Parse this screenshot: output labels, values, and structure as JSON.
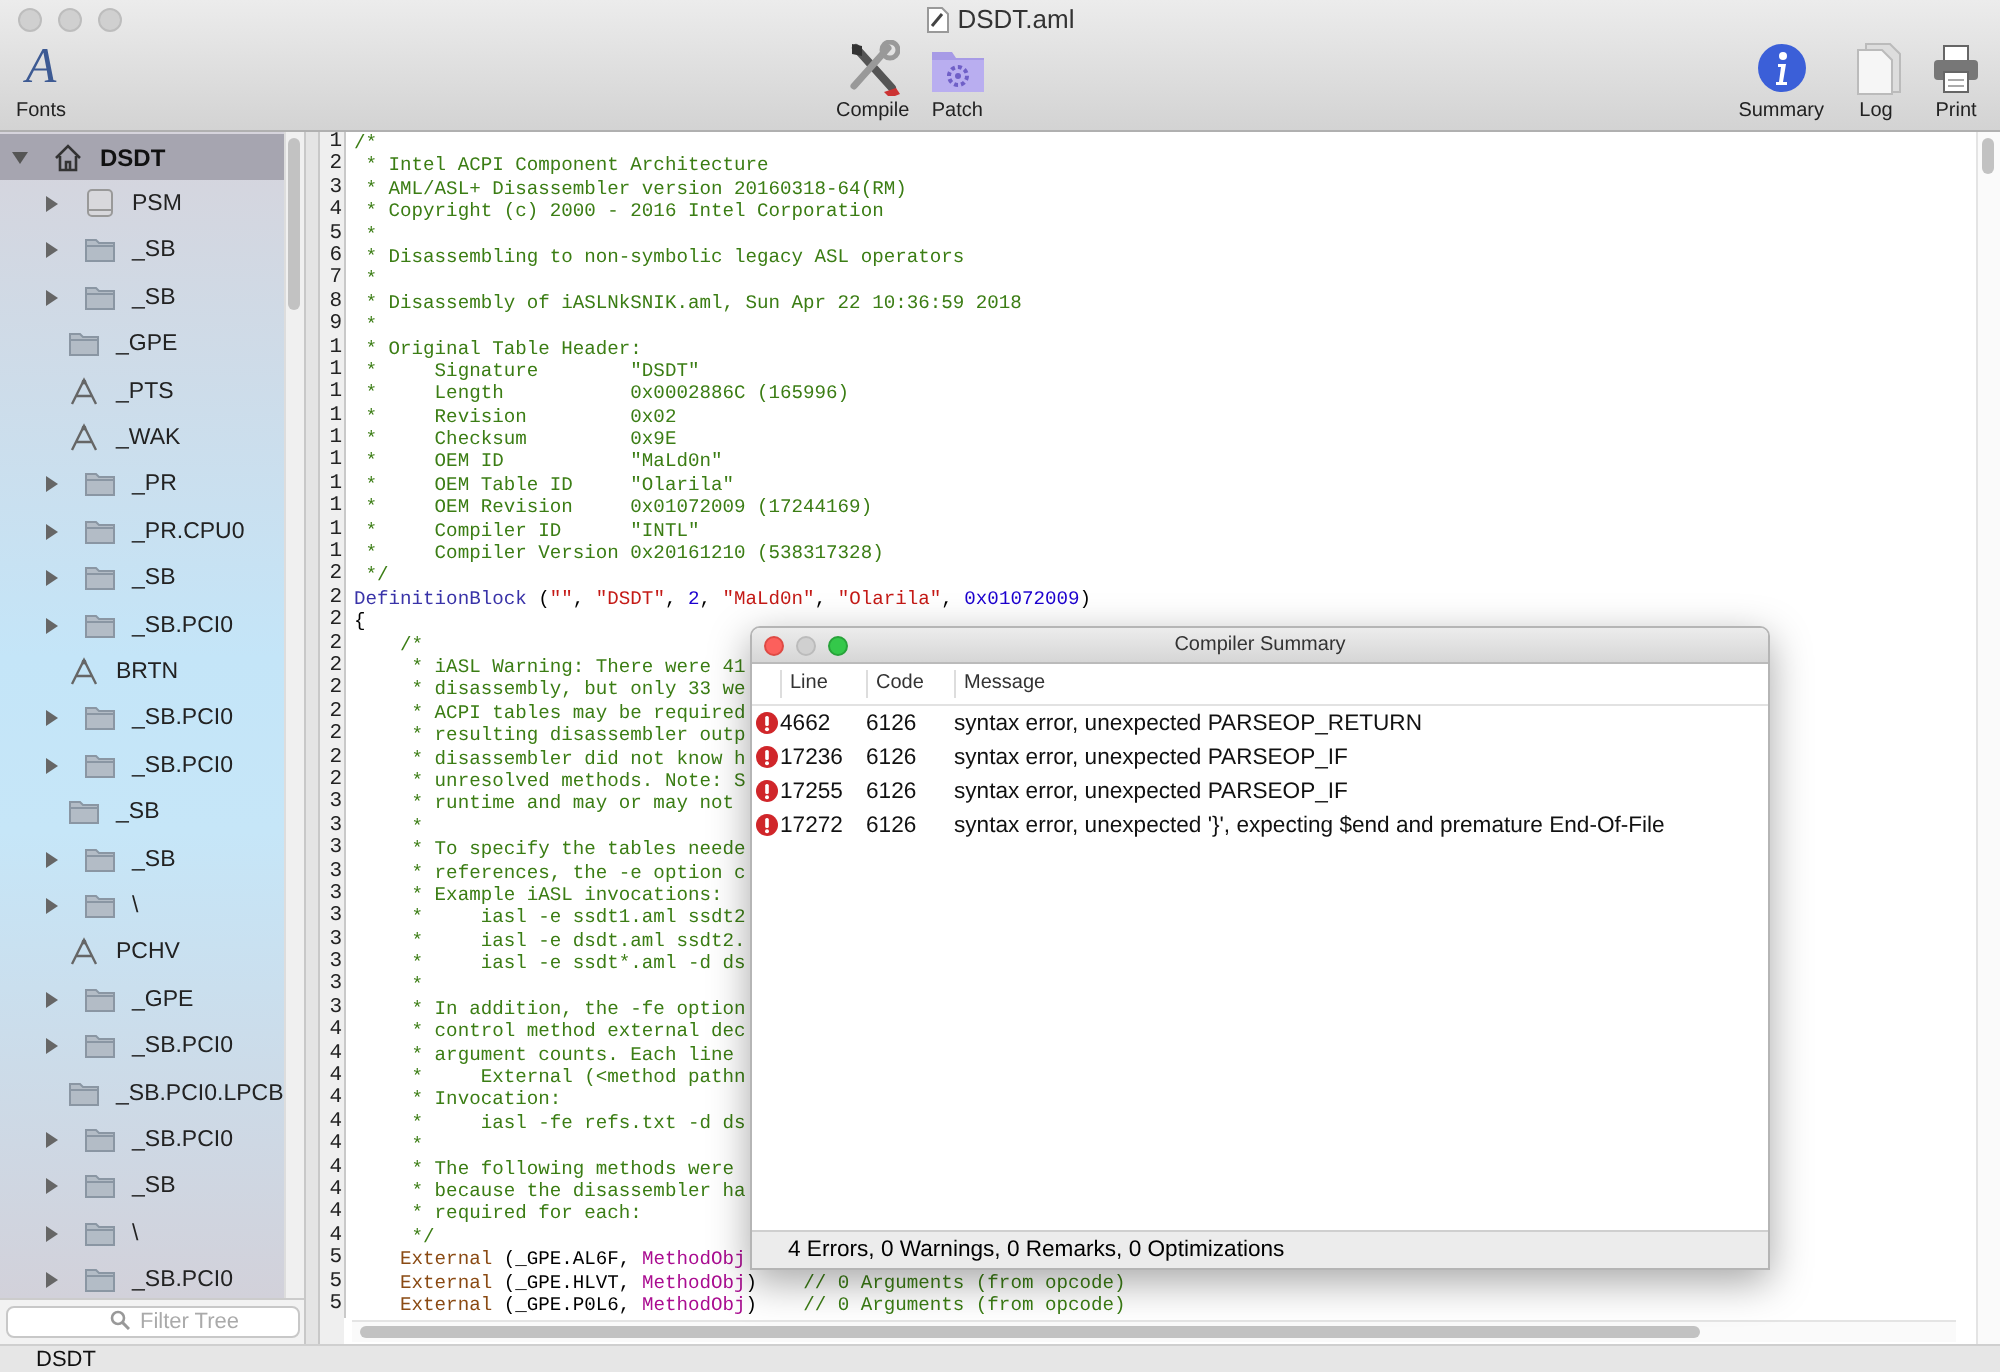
{
  "window": {
    "title": "DSDT.aml"
  },
  "toolbar": [
    {
      "label": "Fonts",
      "kind": "fonts",
      "glyph": "A"
    },
    {
      "label": "Compile",
      "kind": "tools"
    },
    {
      "label": "Patch",
      "kind": "patch"
    },
    {
      "label": "Summary",
      "kind": "info"
    },
    {
      "label": "Log",
      "kind": "log"
    },
    {
      "label": "Print",
      "kind": "print"
    }
  ],
  "tree": {
    "label": "DSDT",
    "kind": "home",
    "expanded": true,
    "selected": true,
    "children": [
      {
        "label": "PSM",
        "kind": "device",
        "expanded": false,
        "selected": false
      },
      {
        "label": "_SB",
        "kind": "folder",
        "expanded": false,
        "selected": false
      },
      {
        "label": "_SB",
        "kind": "folder",
        "expanded": false,
        "selected": false
      },
      {
        "label": "_GPE",
        "kind": "folder",
        "selected": false
      },
      {
        "label": "_PTS",
        "kind": "method",
        "selected": false
      },
      {
        "label": "_WAK",
        "kind": "method",
        "selected": false
      },
      {
        "label": "_PR",
        "kind": "folder",
        "expanded": false,
        "selected": false
      },
      {
        "label": "_PR.CPU0",
        "kind": "folder",
        "expanded": false,
        "selected": false
      },
      {
        "label": "_SB",
        "kind": "folder",
        "expanded": false,
        "selected": false
      },
      {
        "label": "_SB.PCI0",
        "kind": "folder",
        "expanded": false,
        "selected": false
      },
      {
        "label": "BRTN",
        "kind": "method",
        "selected": false
      },
      {
        "label": "_SB.PCI0",
        "kind": "folder",
        "expanded": false,
        "selected": false
      },
      {
        "label": "_SB.PCI0",
        "kind": "folder",
        "expanded": false,
        "selected": false
      },
      {
        "label": "_SB",
        "kind": "folder",
        "selected": false
      },
      {
        "label": "_SB",
        "kind": "folder",
        "expanded": false,
        "selected": false
      },
      {
        "label": "\\",
        "kind": "folder",
        "expanded": false,
        "selected": false
      },
      {
        "label": "PCHV",
        "kind": "method",
        "selected": false
      },
      {
        "label": "_GPE",
        "kind": "folder",
        "expanded": false,
        "selected": false
      },
      {
        "label": "_SB.PCI0",
        "kind": "folder",
        "expanded": false,
        "selected": false
      },
      {
        "label": "_SB.PCI0.LPCB",
        "kind": "folder",
        "selected": false
      },
      {
        "label": "_SB.PCI0",
        "kind": "folder",
        "expanded": false,
        "selected": false
      },
      {
        "label": "_SB",
        "kind": "folder",
        "expanded": false,
        "selected": false
      },
      {
        "label": "\\",
        "kind": "folder",
        "expanded": false,
        "selected": false
      },
      {
        "label": "_SB.PCI0",
        "kind": "folder",
        "expanded": false,
        "selected": false
      }
    ]
  },
  "filter": {
    "placeholder": "Filter Tree"
  },
  "editor": {
    "lines": [
      {
        "number": "1",
        "spans": [
          {
            "kind": "comment",
            "text": "/*"
          }
        ]
      },
      {
        "number": "2",
        "spans": [
          {
            "kind": "comment",
            "text": " * Intel ACPI Component Architecture"
          }
        ]
      },
      {
        "number": "3",
        "spans": [
          {
            "kind": "comment",
            "text": " * AML/ASL+ Disassembler version 20160318-64(RM)"
          }
        ]
      },
      {
        "number": "4",
        "spans": [
          {
            "kind": "comment",
            "text": " * Copyright (c) 2000 - 2016 Intel Corporation"
          }
        ]
      },
      {
        "number": "5",
        "spans": [
          {
            "kind": "comment",
            "text": " *"
          }
        ]
      },
      {
        "number": "6",
        "spans": [
          {
            "kind": "comment",
            "text": " * Disassembling to non-symbolic legacy ASL operators"
          }
        ]
      },
      {
        "number": "7",
        "spans": [
          {
            "kind": "comment",
            "text": " *"
          }
        ]
      },
      {
        "number": "8",
        "spans": [
          {
            "kind": "comment",
            "text": " * Disassembly of iASLNkSNIK.aml, Sun Apr 22 10:36:59 2018"
          }
        ]
      },
      {
        "number": "9",
        "spans": [
          {
            "kind": "comment",
            "text": " *"
          }
        ]
      },
      {
        "number": "1",
        "spans": [
          {
            "kind": "comment",
            "text": " * Original Table Header:"
          }
        ]
      },
      {
        "number": "1",
        "spans": [
          {
            "kind": "comment",
            "text": " *     Signature        \"DSDT\""
          }
        ]
      },
      {
        "number": "1",
        "spans": [
          {
            "kind": "comment",
            "text": " *     Length           0x0002886C (165996)"
          }
        ]
      },
      {
        "number": "1",
        "spans": [
          {
            "kind": "comment",
            "text": " *     Revision         0x02"
          }
        ]
      },
      {
        "number": "1",
        "spans": [
          {
            "kind": "comment",
            "text": " *     Checksum         0x9E"
          }
        ]
      },
      {
        "number": "1",
        "spans": [
          {
            "kind": "comment",
            "text": " *     OEM ID           \"MaLd0n\""
          }
        ]
      },
      {
        "number": "1",
        "spans": [
          {
            "kind": "comment",
            "text": " *     OEM Table ID     \"Olarila\""
          }
        ]
      },
      {
        "number": "1",
        "spans": [
          {
            "kind": "comment",
            "text": " *     OEM Revision     0x01072009 (17244169)"
          }
        ]
      },
      {
        "number": "1",
        "spans": [
          {
            "kind": "comment",
            "text": " *     Compiler ID      \"INTL\""
          }
        ]
      },
      {
        "number": "1",
        "spans": [
          {
            "kind": "comment",
            "text": " *     Compiler Version 0x20161210 (538317328)"
          }
        ]
      },
      {
        "number": "2",
        "spans": [
          {
            "kind": "comment",
            "text": " */"
          }
        ]
      },
      {
        "number": "2",
        "spans": [
          {
            "kind": "keyword",
            "text": "DefinitionBlock"
          },
          {
            "kind": "plain",
            "text": " ("
          },
          {
            "kind": "string",
            "text": "\"\""
          },
          {
            "kind": "plain",
            "text": ", "
          },
          {
            "kind": "string",
            "text": "\"DSDT\""
          },
          {
            "kind": "plain",
            "text": ", "
          },
          {
            "kind": "number",
            "text": "2"
          },
          {
            "kind": "plain",
            "text": ", "
          },
          {
            "kind": "string",
            "text": "\"MaLd0n\""
          },
          {
            "kind": "plain",
            "text": ", "
          },
          {
            "kind": "string",
            "text": "\"Olarila\""
          },
          {
            "kind": "plain",
            "text": ", "
          },
          {
            "kind": "number",
            "text": "0x01072009"
          },
          {
            "kind": "plain",
            "text": ")"
          }
        ]
      },
      {
        "number": "2",
        "spans": [
          {
            "kind": "plain",
            "text": "{"
          }
        ]
      },
      {
        "number": "2",
        "spans": [
          {
            "kind": "comment",
            "text": "    /*"
          }
        ]
      },
      {
        "number": "2",
        "spans": [
          {
            "kind": "comment",
            "text": "     * iASL Warning: There were 41"
          }
        ]
      },
      {
        "number": "2",
        "spans": [
          {
            "kind": "comment",
            "text": "     * disassembly, but only 33 we"
          }
        ]
      },
      {
        "number": "2",
        "spans": [
          {
            "kind": "comment",
            "text": "     * ACPI tables may be required"
          }
        ]
      },
      {
        "number": "2",
        "spans": [
          {
            "kind": "comment",
            "text": "     * resulting disassembler outp"
          }
        ]
      },
      {
        "number": "2",
        "spans": [
          {
            "kind": "comment",
            "text": "     * disassembler did not know h"
          }
        ]
      },
      {
        "number": "2",
        "spans": [
          {
            "kind": "comment",
            "text": "     * unresolved methods. Note: S"
          }
        ]
      },
      {
        "number": "3",
        "spans": [
          {
            "kind": "comment",
            "text": "     * runtime and may or may not"
          }
        ]
      },
      {
        "number": "3",
        "spans": [
          {
            "kind": "comment",
            "text": "     *"
          }
        ]
      },
      {
        "number": "3",
        "spans": [
          {
            "kind": "comment",
            "text": "     * To specify the tables neede"
          }
        ]
      },
      {
        "number": "3",
        "spans": [
          {
            "kind": "comment",
            "text": "     * references, the -e option c"
          }
        ]
      },
      {
        "number": "3",
        "spans": [
          {
            "kind": "comment",
            "text": "     * Example iASL invocations:"
          }
        ]
      },
      {
        "number": "3",
        "spans": [
          {
            "kind": "comment",
            "text": "     *     iasl -e ssdt1.aml ssdt2"
          }
        ]
      },
      {
        "number": "3",
        "spans": [
          {
            "kind": "comment",
            "text": "     *     iasl -e dsdt.aml ssdt2."
          }
        ]
      },
      {
        "number": "3",
        "spans": [
          {
            "kind": "comment",
            "text": "     *     iasl -e ssdt*.aml -d ds"
          }
        ]
      },
      {
        "number": "3",
        "spans": [
          {
            "kind": "comment",
            "text": "     *"
          }
        ]
      },
      {
        "number": "3",
        "spans": [
          {
            "kind": "comment",
            "text": "     * In addition, the -fe option"
          }
        ]
      },
      {
        "number": "4",
        "spans": [
          {
            "kind": "comment",
            "text": "     * control method external dec"
          }
        ]
      },
      {
        "number": "4",
        "spans": [
          {
            "kind": "comment",
            "text": "     * argument counts. Each line"
          }
        ]
      },
      {
        "number": "4",
        "spans": [
          {
            "kind": "comment",
            "text": "     *     External (<method pathn"
          }
        ]
      },
      {
        "number": "4",
        "spans": [
          {
            "kind": "comment",
            "text": "     * Invocation:"
          }
        ]
      },
      {
        "number": "4",
        "spans": [
          {
            "kind": "comment",
            "text": "     *     iasl -fe refs.txt -d ds"
          }
        ]
      },
      {
        "number": "4",
        "spans": [
          {
            "kind": "comment",
            "text": "     *"
          }
        ]
      },
      {
        "number": "4",
        "spans": [
          {
            "kind": "comment",
            "text": "     * The following methods were"
          }
        ]
      },
      {
        "number": "4",
        "spans": [
          {
            "kind": "comment",
            "text": "     * because the disassembler ha"
          }
        ]
      },
      {
        "number": "4",
        "spans": [
          {
            "kind": "comment",
            "text": "     * required for each:"
          }
        ]
      },
      {
        "number": "4",
        "spans": [
          {
            "kind": "comment",
            "text": "     */"
          }
        ]
      },
      {
        "number": "5",
        "spans": [
          {
            "kind": "external",
            "text": "    External"
          },
          {
            "kind": "plain",
            "text": " (_GPE.AL6F, "
          },
          {
            "kind": "type",
            "text": "MethodObj"
          }
        ]
      },
      {
        "number": "5",
        "spans": [
          {
            "kind": "external",
            "text": "    External"
          },
          {
            "kind": "plain",
            "text": " (_GPE.HLVT, "
          },
          {
            "kind": "type",
            "text": "MethodObj"
          },
          {
            "kind": "plain",
            "text": ")    "
          },
          {
            "kind": "comment",
            "text": "// 0 Arguments (from opcode)"
          }
        ]
      },
      {
        "number": "5",
        "spans": [
          {
            "kind": "external",
            "text": "    External"
          },
          {
            "kind": "plain",
            "text": " (_GPE.P0L6, "
          },
          {
            "kind": "type",
            "text": "MethodObj"
          },
          {
            "kind": "plain",
            "text": ")    "
          },
          {
            "kind": "comment",
            "text": "// 0 Arguments (from opcode)"
          }
        ]
      }
    ]
  },
  "summary": {
    "title": "Compiler Summary",
    "columns": [
      "Line",
      "Code",
      "Message"
    ],
    "rows": [
      {
        "kind": "error",
        "line": "4662",
        "code": "6126",
        "message": "syntax error, unexpected PARSEOP_RETURN"
      },
      {
        "kind": "error",
        "line": "17236",
        "code": "6126",
        "message": "syntax error, unexpected PARSEOP_IF"
      },
      {
        "kind": "error",
        "line": "17255",
        "code": "6126",
        "message": "syntax error, unexpected PARSEOP_IF"
      },
      {
        "kind": "error",
        "line": "17272",
        "code": "6126",
        "message": "syntax error, unexpected '}', expecting $end and premature End-Of-File"
      }
    ],
    "footer": "4 Errors, 0 Warnings, 0 Remarks, 0 Optimizations"
  },
  "status_bar": "DSDT"
}
